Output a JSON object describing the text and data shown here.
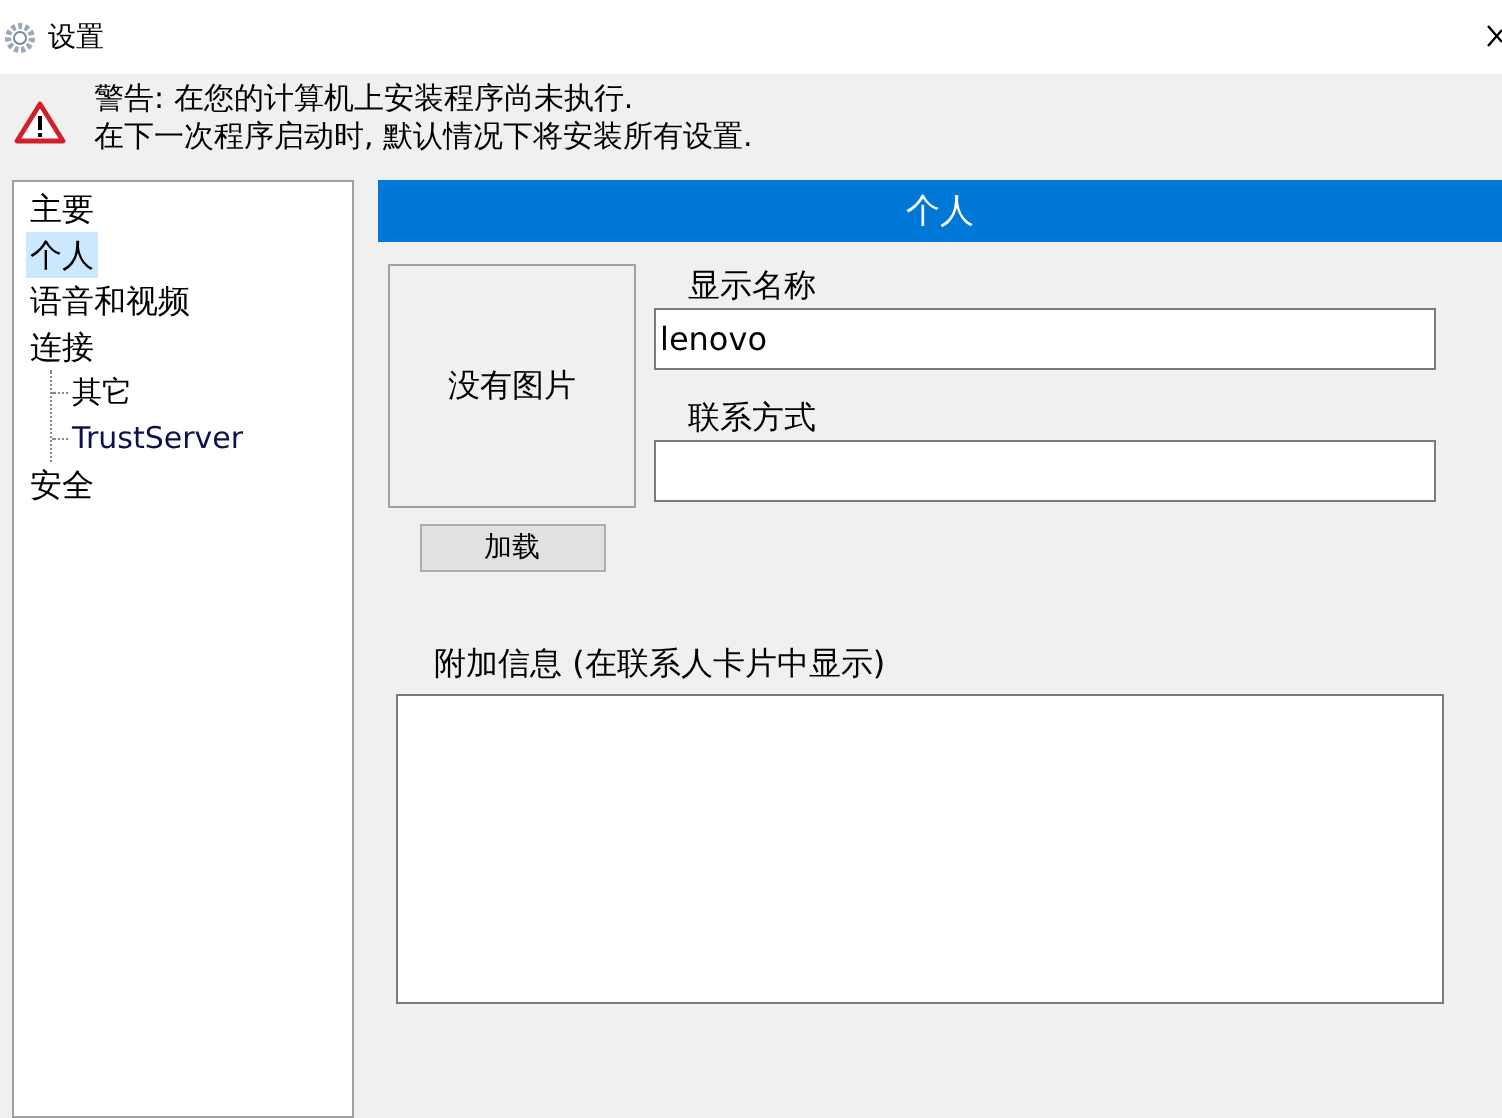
{
  "window": {
    "title": "设置"
  },
  "warning": {
    "lines": [
      "警告: 在您的计算机上安装程序尚未执行.",
      "在下一次程序启动时, 默认情况下将安装所有设置."
    ]
  },
  "sidebar": {
    "items": [
      {
        "label": "主要",
        "selected": false
      },
      {
        "label": "个人",
        "selected": true
      },
      {
        "label": "语音和视频",
        "selected": false
      },
      {
        "label": "连接",
        "selected": false,
        "children": [
          {
            "label": "其它",
            "selected": false
          },
          {
            "label": "TrustServer",
            "selected": false
          }
        ]
      },
      {
        "label": "安全",
        "selected": false
      }
    ]
  },
  "panel": {
    "title": "个人",
    "picture_text": "没有图片",
    "load_button": "加载",
    "fields": [
      {
        "label": "显示名称",
        "value": "lenovo"
      },
      {
        "label": "联系方式"
      }
    ],
    "notes": {
      "label": "附加信息 (在联系人卡片中显示)"
    }
  }
}
